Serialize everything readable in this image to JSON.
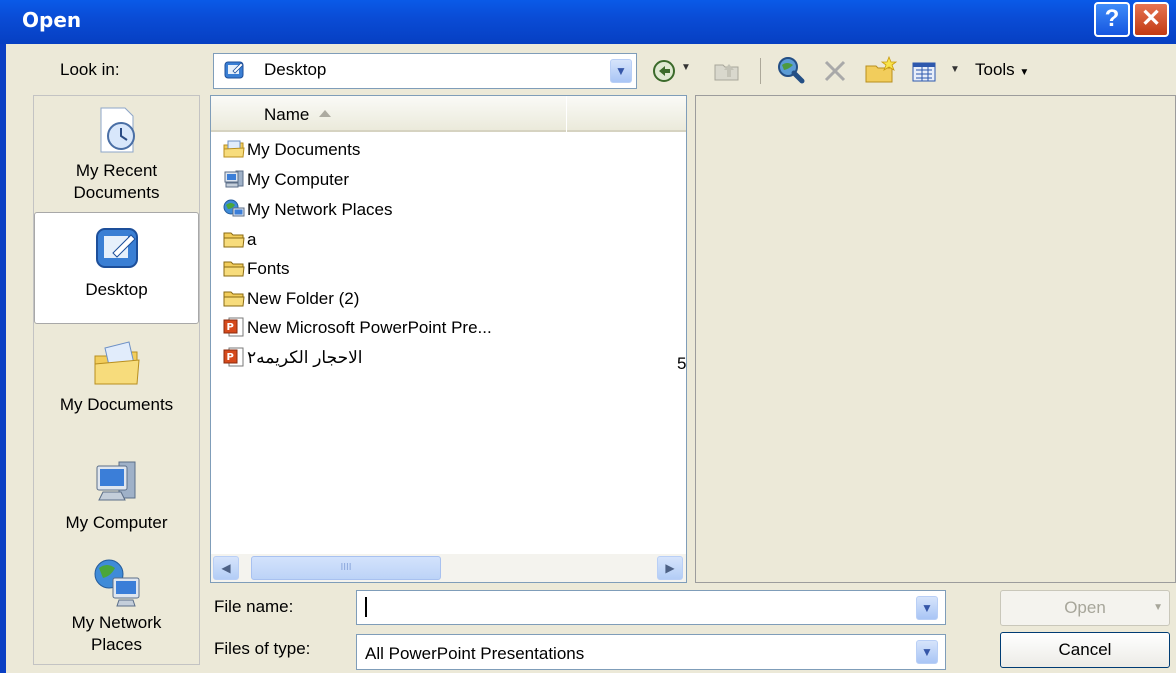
{
  "window": {
    "title": "Open",
    "help_label": "?",
    "close_label": "✕"
  },
  "lookin": {
    "label": "Look in:",
    "value": "Desktop",
    "icon": "desktop-icon"
  },
  "toolbar": {
    "back_icon": "back-icon",
    "up_icon": "up-one-level-icon",
    "search_icon": "search-web-icon",
    "delete_icon": "delete-icon",
    "newfolder_icon": "new-folder-icon",
    "views_icon": "views-icon",
    "tools_label": "Tools"
  },
  "places": [
    {
      "line1": "My Recent",
      "line2": "Documents",
      "icon": "recent-documents-icon",
      "selected": false
    },
    {
      "line1": "Desktop",
      "line2": "",
      "icon": "desktop-icon",
      "selected": true
    },
    {
      "line1": "My Documents",
      "line2": "",
      "icon": "my-documents-icon",
      "selected": false
    },
    {
      "line1": "My Computer",
      "line2": "",
      "icon": "my-computer-icon",
      "selected": false
    },
    {
      "line1": "My Network",
      "line2": "Places",
      "icon": "network-places-icon",
      "selected": false
    }
  ],
  "filelist": {
    "column_name": "Name",
    "sort": "ascending",
    "items": [
      {
        "name": "My Documents",
        "icon": "my-documents-icon"
      },
      {
        "name": "My Computer",
        "icon": "my-computer-icon"
      },
      {
        "name": "My Network Places",
        "icon": "network-places-icon"
      },
      {
        "name": "a",
        "icon": "folder-icon"
      },
      {
        "name": "Fonts",
        "icon": "folder-icon"
      },
      {
        "name": "New Folder (2)",
        "icon": "folder-icon"
      },
      {
        "name": "New Microsoft PowerPoint Pre...",
        "icon": "powerpoint-file-icon"
      },
      {
        "name": "الاحجار الكريمه٢",
        "icon": "powerpoint-file-icon",
        "trailing": "5"
      }
    ],
    "scroll_grip": "IIII"
  },
  "form": {
    "filename_label": "File name:",
    "filename_value": "",
    "filetype_label": "Files of type:",
    "filetype_value": "All PowerPoint Presentations",
    "open_label": "Open",
    "cancel_label": "Cancel"
  },
  "colors": {
    "titlebar": "#0a4cd6",
    "dialog_bg": "#ece9d8",
    "close_red": "#c23a12"
  }
}
